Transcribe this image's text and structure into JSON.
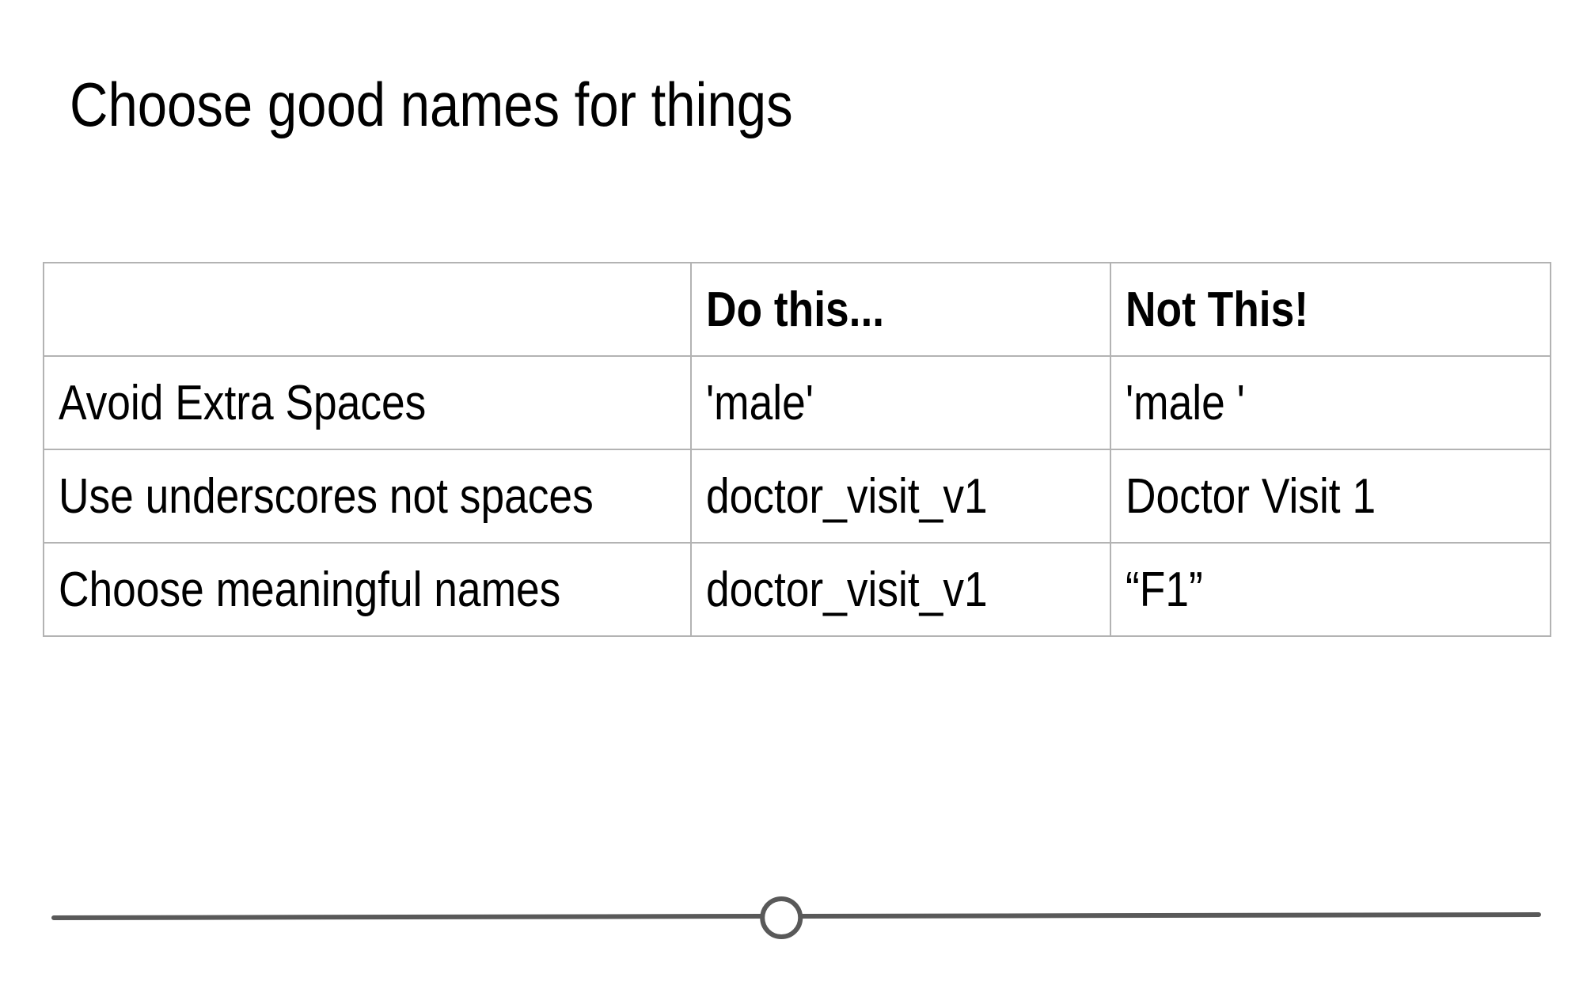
{
  "slide": {
    "title": "Choose good names for things"
  },
  "table": {
    "headers": [
      "",
      "Do this...",
      "Not This!"
    ],
    "rows": [
      [
        "Avoid Extra Spaces",
        "'male'",
        "'male '"
      ],
      [
        "Use underscores not spaces",
        "doctor_visit_v1",
        "Doctor Visit 1"
      ],
      [
        "Choose meaningful names",
        "doctor_visit_v1",
        "“F1”"
      ]
    ]
  },
  "slider": {
    "value": 0.49,
    "track_color": "#595959",
    "handle_fill": "#ffffff"
  }
}
